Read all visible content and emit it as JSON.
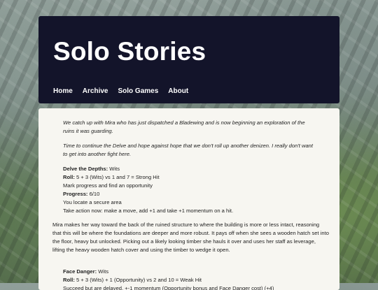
{
  "site": {
    "title": "Solo Stories",
    "nav": [
      "Home",
      "Archive",
      "Solo Games",
      "About"
    ]
  },
  "post": {
    "intro1": "We catch up with Mira who has just dispatched a Bladewing and is now beginning an exploration of the ruins it was guarding.",
    "intro2": "Time to continue the Delve and hope against hope that we don't roll up another denizen. I really don't want to get into another fight here.",
    "move1": {
      "name_label": "Delve the Depths:",
      "name_value": " Wits",
      "roll_label": "Roll:",
      "roll_value": " 5 + 3 (Wits) vs 1 and 7 = Strong Hit",
      "line1": "Mark progress and find an opportunity",
      "progress_label": "Progress:",
      "progress_value": " 6/10",
      "line2": "You locate a secure area",
      "line3": "Take action now: make a move, add +1 and take +1 momentum on a hit."
    },
    "narrative": "Mira makes her way toward the back of the ruined structure to where the building is more or less intact, reasoning that this will be where the foundations are deeper and more robust. It pays off when she sees a wooden hatch set into the floor, heavy but unlocked. Picking out a likely looking timber she hauls it over and uses her staff as leverage, lifting the heavy wooden hatch cover and using the timber to wedge it open.",
    "move2": {
      "name_label": "Face Danger:",
      "name_value": " Wits",
      "roll_label": "Roll:",
      "roll_value": " 5 + 3 (Wits) + 1 (Opportunity) vs 2 and 10 = Weak Hit",
      "line1": "Succeed but are delayed, +-1 momentum (Opportunity bonus and Face Danger cost) (+4)"
    }
  }
}
